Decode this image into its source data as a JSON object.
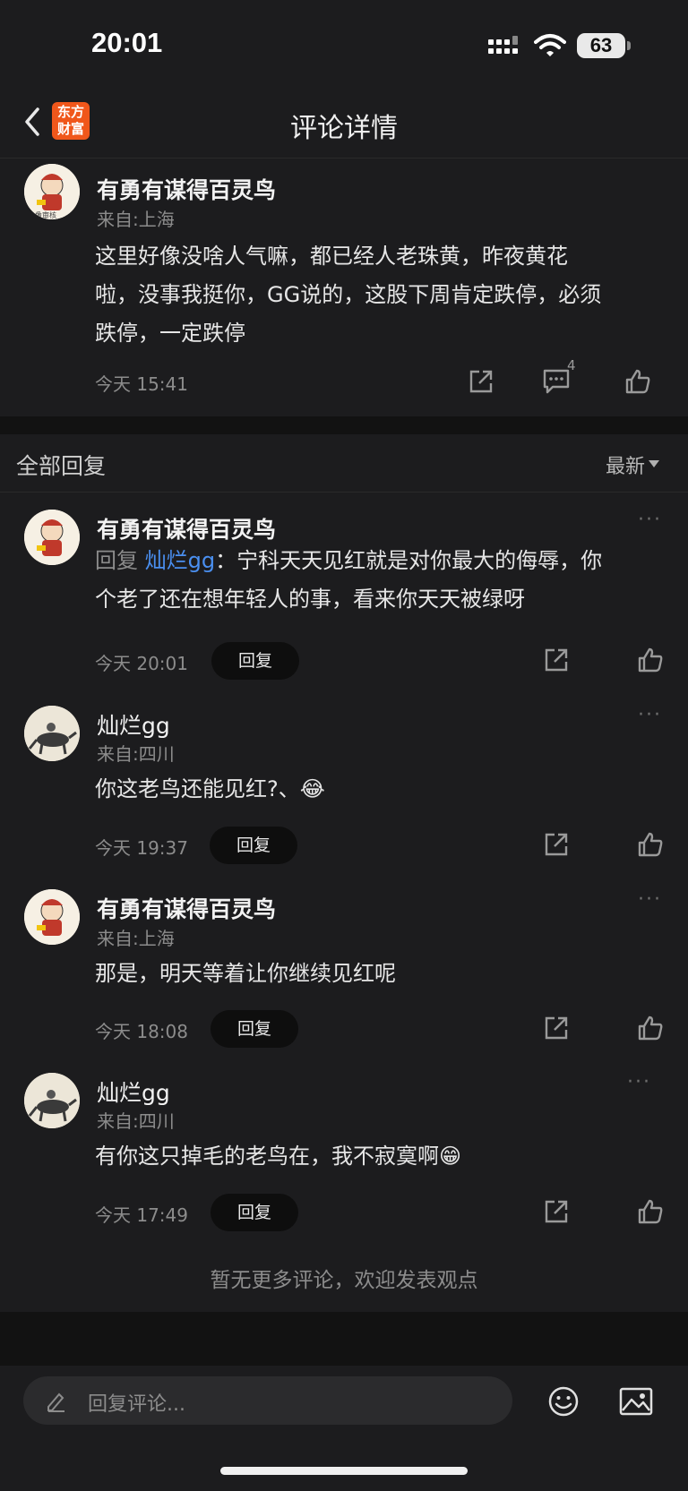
{
  "status": {
    "time": "20:01",
    "battery": "63"
  },
  "nav": {
    "title": "评论详情",
    "logo_line1": "东方",
    "logo_line2": "财富"
  },
  "main_comment": {
    "user": "有勇有谋得百灵鸟",
    "location": "来自:上海",
    "text_line1": "这里好像没啥人气嘛，都已经人老珠黄，昨夜黄花",
    "text_line2": "啦，没事我挺你，GG说的，这股下周肯定跌停，必须",
    "text_line3": "跌停，一定跌停",
    "time": "今天 15:41",
    "comment_count": "4"
  },
  "section": {
    "title": "全部回复",
    "sort": "最新"
  },
  "replies": [
    {
      "user": "有勇有谋得百灵鸟",
      "reply_prefix": "回复 ",
      "reply_target": "灿烂gg",
      "text_line1": "：宁科天天见红就是对你最大的侮辱，你",
      "text_line2": "个老了还在想年轻人的事，看来你天天被绿呀",
      "time": "今天 20:01",
      "reply_label": "回复"
    },
    {
      "user": "灿烂gg",
      "location": "来自:四川",
      "text": "你这老鸟还能见红?、😂",
      "time": "今天 19:37",
      "reply_label": "回复"
    },
    {
      "user": "有勇有谋得百灵鸟",
      "location": "来自:上海",
      "text": "那是，明天等着让你继续见红呢",
      "time": "今天 18:08",
      "reply_label": "回复"
    },
    {
      "user": "灿烂gg",
      "location": "来自:四川",
      "text": "有你这只掉毛的老鸟在，我不寂寞啊😁",
      "time": "今天 17:49",
      "reply_label": "回复"
    }
  ],
  "end_text": "暂无更多评论，欢迎发表观点",
  "bottom": {
    "placeholder": "回复评论..."
  },
  "avatar_caption": "头像审核"
}
